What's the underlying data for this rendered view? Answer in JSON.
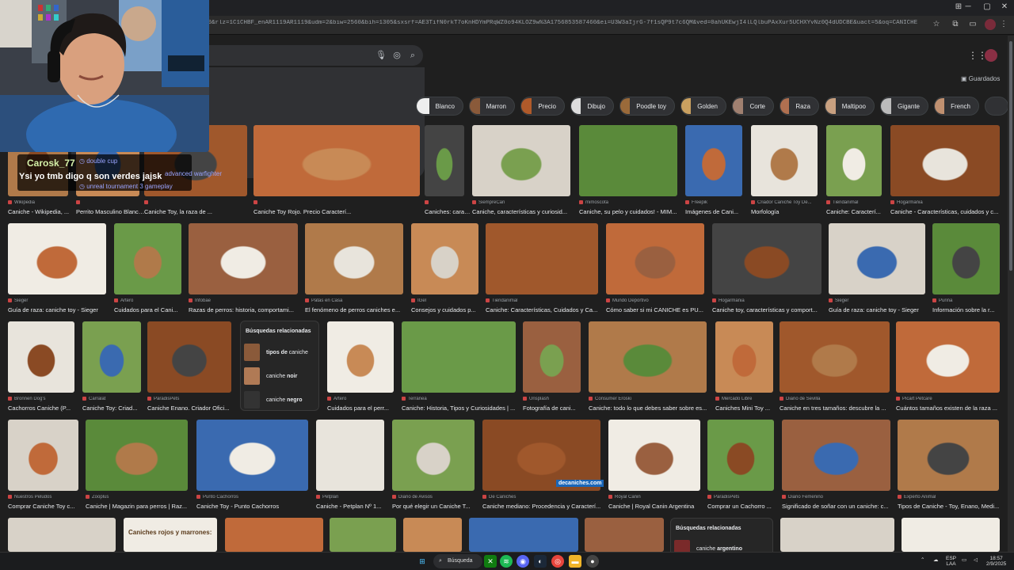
{
  "browser": {
    "url": "d0&rlz=1C1CHBF_enAR1119AR1119&udm=2&biw=2560&bih=1305&sxsrf=AE3TifN0rkT7oKnHDYmPRqWZ0o94KLOZ9w%3A1756853587460&ei=U3W3aIjrG-7f1sQP9t7c6QM&ved=0ahUKEwjI4lLQlbuPAxXur5UCHXYvNz0Q4dUDCBE&uact=5&oq=CANICHE&gs_lp=EgNpbWciCENB..."
  },
  "search": {
    "suggestions": [
      "double cup",
      "advanced warfighter",
      "unreal tournament 3 gameplay"
    ]
  },
  "header": {
    "saved_label": "Guardados"
  },
  "chips": [
    "Blanco",
    "Marron",
    "Precio",
    "Dibujo",
    "Poodle toy",
    "Golden",
    "Corte",
    "Raza",
    "Maltipoo",
    "Gigante",
    "French"
  ],
  "rows": [
    [
      {
        "source": "Wikipedia",
        "title": "Caniche - Wikipedia, ..."
      },
      {
        "source": "",
        "title": "Perrito Masculino Blanco Lindo ..."
      },
      {
        "source": "",
        "title": "Caniche Toy, la raza de ..."
      },
      {
        "source": "",
        "title": "Caniche Toy Rojo. Precio Caracterí..."
      },
      {
        "source": "",
        "title": "Caniches: características de esta r..."
      },
      {
        "source": "SiempreCan",
        "title": "Caniche, características y curiosid..."
      },
      {
        "source": "mimoscota",
        "title": "Caniche, su pelo y cuidados! - MIM..."
      },
      {
        "source": "Freepik",
        "title": "Imágenes de Cani..."
      },
      {
        "source": "Criador Caniche Toy De...",
        "title": "Morfología"
      },
      {
        "source": "Tiendanimal",
        "title": "Caniche: Caracterí..."
      },
      {
        "source": "Hogarmania",
        "title": "Caniche - Características, cuidados y c..."
      }
    ],
    [
      {
        "source": "Sieger",
        "title": "Guía de raza: caniche toy - Sieger"
      },
      {
        "source": "Artero",
        "title": "Cuidados para el Cani..."
      },
      {
        "source": "Infobae",
        "title": "Razas de perros: historia, comportami..."
      },
      {
        "source": "Patas en Casa",
        "title": "El fenómeno de perros caniches e..."
      },
      {
        "source": "IGel",
        "title": "Consejos y cuidados p..."
      },
      {
        "source": "Tiendanimal",
        "title": "Caniche: Características, Cuidados y Ca..."
      },
      {
        "source": "Mundo Deportivo",
        "title": "Cómo saber si mi CANICHE es PU..."
      },
      {
        "source": "Hogarmania",
        "title": "Caniche toy, características y comport..."
      },
      {
        "source": "Sieger",
        "title": "Guía de raza: caniche toy - Sieger"
      },
      {
        "source": "Purina",
        "title": "Información sobre la r..."
      }
    ],
    [
      {
        "source": "Bronnen Dog's",
        "title": "Cachorros Caniche (P..."
      },
      {
        "source": "Carralat",
        "title": "Caniche Toy: Criad..."
      },
      {
        "source": "ParadisPets",
        "title": "Caniche Enano. Criador Ofici..."
      },
      {
        "source": "Artero",
        "title": "Cuidados para el perr..."
      },
      {
        "source": "Terránea",
        "title": "Caniche: Historia, Tipos y Curiosidades | ..."
      },
      {
        "source": "Unsplash",
        "title": "Fotografía de cani..."
      },
      {
        "source": "Consumer Eroski",
        "title": "Caniche: todo lo que debes saber sobre es..."
      },
      {
        "source": "Mercado Libre",
        "title": "Caniches Mini Toy ..."
      },
      {
        "source": "Diario de Sevilla",
        "title": "Caniche en tres tamaños: descubre la ..."
      },
      {
        "source": "Picart Petcare",
        "title": "Cuántos tamaños existen de la raza ..."
      }
    ],
    [
      {
        "source": "Nuestros Peludos",
        "title": "Comprar Caniche Toy c..."
      },
      {
        "source": "Zooplus",
        "title": "Caniche | Magazin para perros | Raz..."
      },
      {
        "source": "Punto Cachorros",
        "title": "Caniche Toy - Punto Cachorros"
      },
      {
        "source": "Petplan",
        "title": "Caniche - Petplan Nº 1..."
      },
      {
        "source": "Diario de Avisos",
        "title": "Por qué elegir un Caniche T..."
      },
      {
        "source": "De Caniches",
        "title": "Caniche mediano: Procedencia y Caracterí..."
      },
      {
        "source": "Royal Canin",
        "title": "Caniche | Royal Canin Argentina"
      },
      {
        "source": "ParadisPets",
        "title": "Comprar un Cachorro ..."
      },
      {
        "source": "Diario Femenino",
        "title": "Significado de soñar con un caniche: c..."
      },
      {
        "source": "Experto Animal",
        "title": "Tipos de Caniche - Toy, Enano, Medi..."
      }
    ]
  ],
  "related1": {
    "heading": "Búsquedas relacionadas",
    "items": [
      {
        "bold": "tipos de",
        "rest": " caniche",
        "first_bold": true
      },
      {
        "bold": "noir",
        "rest": "caniche ",
        "first_bold": false
      },
      {
        "bold": "negro",
        "rest": "caniche ",
        "first_bold": false
      }
    ]
  },
  "related2": {
    "heading": "Búsquedas relacionadas",
    "item_plain": "caniche ",
    "item_bold": "argentino"
  },
  "overlay_text": "Caniches rojos y marrones:",
  "decaniches_banner": "decaniches.com",
  "chat": {
    "username": "Carosk_77",
    "message": "Ysi yo tmb digo q son verdes jajsk"
  },
  "taskbar": {
    "search_label": "Búsqueda",
    "lang_top": "ESP",
    "lang_bottom": "LAA",
    "time": "18:57",
    "date": "2/9/2025"
  },
  "colors": {
    "page_bg": "#1f1f1f",
    "chip_bg": "#303134",
    "text": "#e8eaed",
    "chat_user": "#d4f0a8"
  }
}
